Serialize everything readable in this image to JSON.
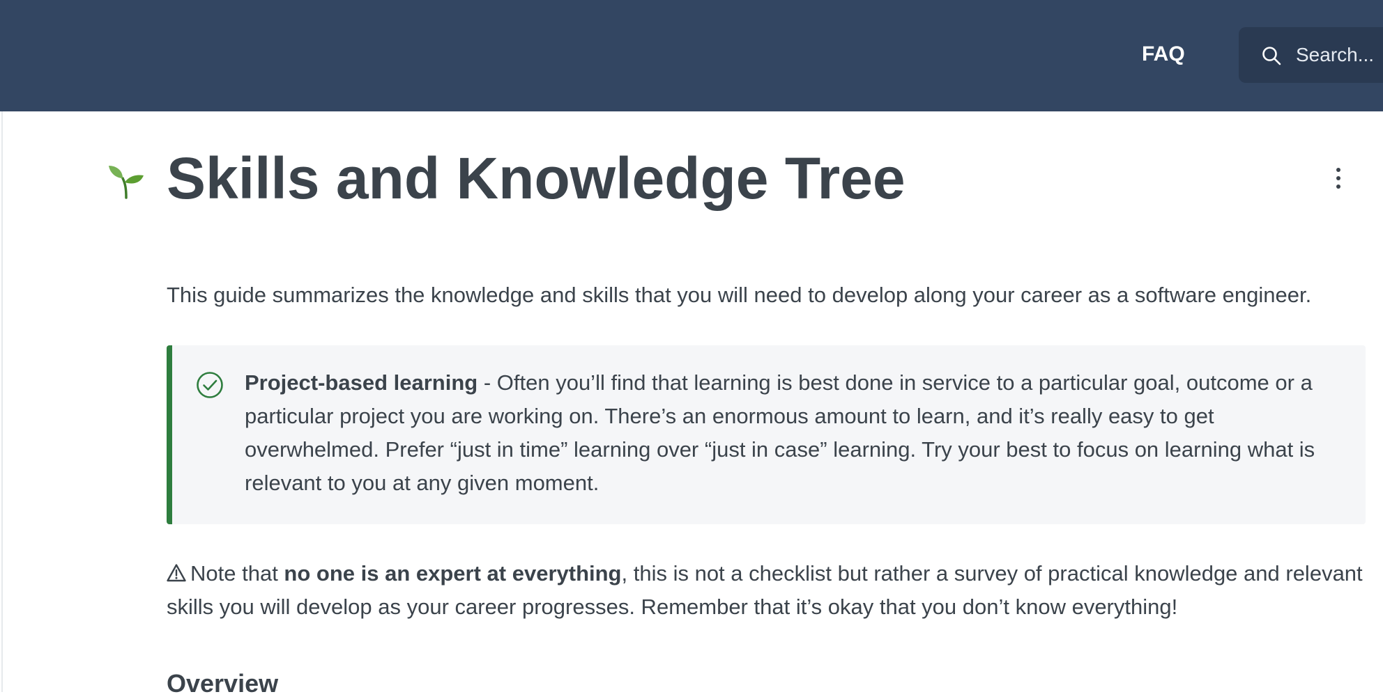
{
  "header": {
    "faq_label": "FAQ",
    "search_placeholder": "Search...",
    "background_color": "#334662",
    "search_icon": "search-icon"
  },
  "page": {
    "icon": "seedling-emoji",
    "icon_glyph": "🌱",
    "title": "Skills and Knowledge Tree",
    "more_icon": "more-vertical-icon",
    "intro": "This guide summarizes the knowledge and skills that you will need to develop along your career as a software engineer.",
    "callout": {
      "icon": "check-circle-icon",
      "accent_color": "#2e7d3e",
      "title": "Project-based learning",
      "body": " - Often you’ll find that learning is best done in service to a particular goal, outcome or a particular project you are working on. There’s an enormous amount to learn, and it’s really easy to get overwhelmed. Prefer “just in time” learning over “just in case” learning. Try your best to focus on learning what is relevant to you at any given moment."
    },
    "note": {
      "icon": "warning-icon",
      "prefix": "Note that ",
      "emphasis": "no one is an expert at everything",
      "suffix": ", this is not a checklist but rather a survey of practical knowledge and relevant skills you will develop as your career progresses. Remember that it’s okay that you don’t know everything!"
    },
    "section_heading": "Overview"
  }
}
